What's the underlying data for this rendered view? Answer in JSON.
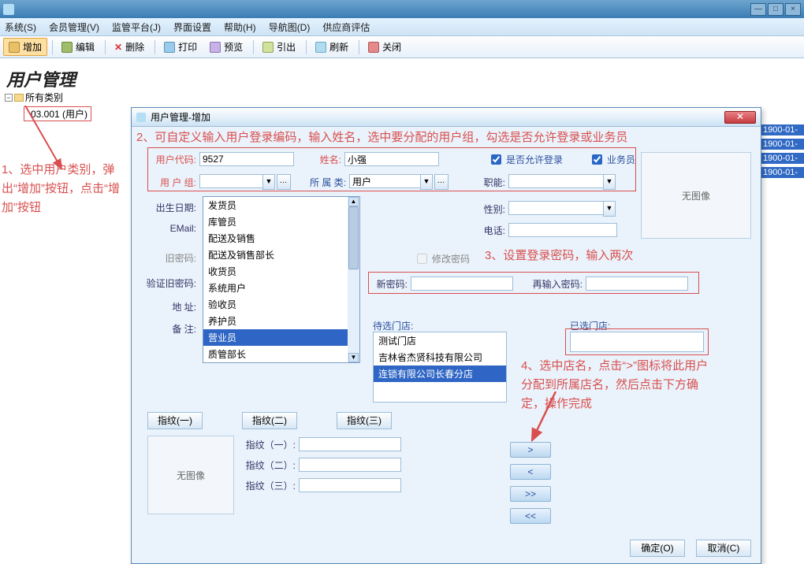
{
  "menubar": [
    "系统(S)",
    "会员管理(V)",
    "监管平台(J)",
    "界面设置",
    "帮助(H)",
    "导航图(D)",
    "供应商评估"
  ],
  "toolbar": {
    "add": "增加",
    "edit": "编辑",
    "del": "删除",
    "print": "打印",
    "preview": "预览",
    "export": "引出",
    "refresh": "刷新",
    "close": "关闭"
  },
  "panel_title": "用户管理",
  "tree": {
    "root": "所有类别",
    "child": "03.001 (用户)"
  },
  "annotations": {
    "a1": "1、选中用户类别，弹出“增加”按钮，点击“增加”按钮",
    "a2": "2、可自定义输入用户登录编码，输入姓名，选中要分配的用户组，勾选是否允许登录或业务员",
    "a3": "3、设置登录密码，输入两次",
    "a4": "4、选中店名，点击“>”图标将此用户分配到所属店名，然后点击下方确定，操作完成"
  },
  "right_dates": [
    "1900-01-",
    "1900-01-",
    "1900-01-",
    "1900-01-"
  ],
  "dialog": {
    "title": "用户管理-增加",
    "labels": {
      "user_code": "用户代码:",
      "name": "姓名:",
      "allow_login": "是否允许登录",
      "is_sales": "业务员",
      "user_group": "用 户 组:",
      "category": "所 属 类:",
      "position": "职能:",
      "birth": "出生日期:",
      "gender": "性别:",
      "email": "EMail:",
      "phone": "电话:",
      "old_pwd": "旧密码:",
      "change_pwd": "修改密码",
      "new_pwd": "新密码:",
      "re_pwd": "再输入密码:",
      "verify_pwd": "验证旧密码:",
      "address": "地    址:",
      "remark": "备    注:",
      "pending": "待选门店:",
      "selected": "已选门店:",
      "fp1": "指纹(一)",
      "fp2": "指纹(二)",
      "fp3": "指纹(三)",
      "fp1v": "指纹（一）:",
      "fp2v": "指纹（二）:",
      "fp3v": "指纹（三）:",
      "no_image": "无图像",
      "ok": "确定(O)",
      "cancel": "取消(C)"
    },
    "values": {
      "user_code": "9527",
      "name": "小强",
      "category": "用户",
      "allow_login": true,
      "is_sales": true
    },
    "group_options": [
      "发货员",
      "库管员",
      "配送及销售",
      "配送及销售部长",
      "收货员",
      "系统用户",
      "验收员",
      "养护员",
      "营业员",
      "质管部长"
    ],
    "group_selected_index": 8,
    "pending_list": [
      "测试门店",
      "吉林省杰贤科技有限公司",
      "连锁有限公司长春分店"
    ],
    "pending_selected_index": 2,
    "move_btns": [
      ">",
      "<",
      ">>",
      "<<"
    ]
  }
}
